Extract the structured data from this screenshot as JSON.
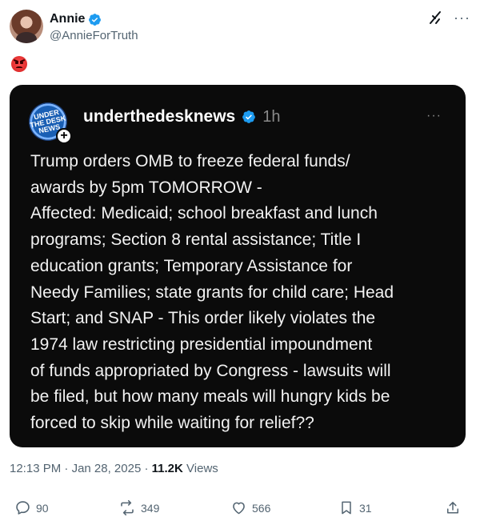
{
  "author": {
    "display_name": "Annie",
    "handle": "@AnnieForTruth"
  },
  "post": {
    "emoji": "angry-face-emoji"
  },
  "quoted": {
    "account": "underthedesknews",
    "time": "1h",
    "avatar_text": "UNDER THE DESK NEWS",
    "text": "Trump orders OMB to freeze federal funds/\nawards by 5pm TOMORROW -\nAffected: Medicaid; school breakfast and lunch\nprograms; Section 8 rental assistance; Title I\neducation grants; Temporary Assistance for\nNeedy Families; state grants for child care; Head\nStart; and SNAP - This order likely violates the\n1974 law restricting presidential impoundment\nof funds appropriated by Congress - lawsuits will\nbe filed, but how many meals will hungry kids be\nforced to skip while waiting for relief??"
  },
  "meta": {
    "time": "12:13 PM",
    "date": "Jan 28, 2025",
    "views_count": "11.2K",
    "views_label": "Views",
    "sep": " · "
  },
  "actions": {
    "replies": "90",
    "reposts": "349",
    "likes": "566",
    "bookmarks": "31"
  },
  "colors": {
    "verified": "#1d9bf0",
    "quote_bg": "#0b0b0b",
    "muted": "#536471"
  }
}
